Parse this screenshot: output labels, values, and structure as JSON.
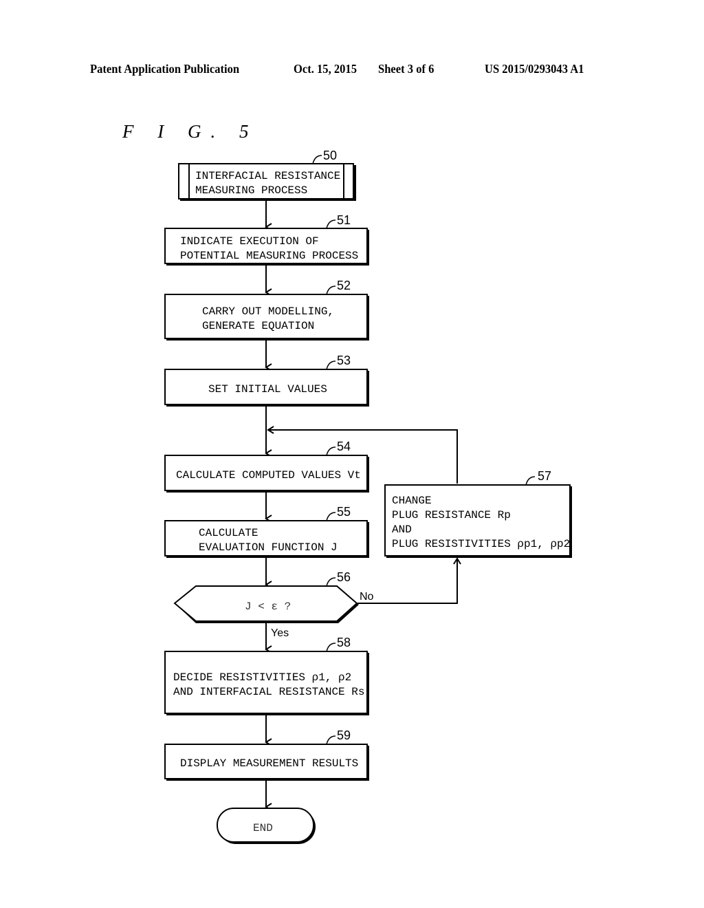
{
  "header": {
    "publication": "Patent Application Publication",
    "date": "Oct. 15, 2015",
    "sheet": "Sheet 3 of 6",
    "patent_number": "US 2015/0293043 A1"
  },
  "figure_label": "F I G. 5",
  "flowchart": {
    "steps": [
      {
        "ref": "50",
        "type": "predefined-process",
        "lines": [
          "INTERFACIAL RESISTANCE",
          "MEASURING PROCESS"
        ]
      },
      {
        "ref": "51",
        "type": "process",
        "lines": [
          "INDICATE EXECUTION OF",
          "POTENTIAL MEASURING PROCESS"
        ]
      },
      {
        "ref": "52",
        "type": "process",
        "lines": [
          "CARRY OUT MODELLING,",
          "GENERATE EQUATION"
        ]
      },
      {
        "ref": "53",
        "type": "process",
        "lines": [
          "SET INITIAL VALUES"
        ]
      },
      {
        "ref": "54",
        "type": "process",
        "lines": [
          "CALCULATE COMPUTED VALUES Vt"
        ]
      },
      {
        "ref": "55",
        "type": "process",
        "lines": [
          "CALCULATE",
          "EVALUATION FUNCTION J"
        ]
      },
      {
        "ref": "56",
        "type": "decision",
        "lines": [
          "J < ε ?"
        ]
      },
      {
        "ref": "57",
        "type": "process",
        "lines": [
          "CHANGE",
          "PLUG RESISTANCE Rp",
          "AND",
          "PLUG RESISTIVITIES ρp1, ρp2"
        ]
      },
      {
        "ref": "58",
        "type": "process",
        "lines": [
          "DECIDE RESISTIVITIES ρ1, ρ2",
          "AND INTERFACIAL RESISTANCE Rs"
        ]
      },
      {
        "ref": "59",
        "type": "process",
        "lines": [
          "DISPLAY MEASUREMENT RESULTS"
        ]
      },
      {
        "ref": "",
        "type": "terminator",
        "lines": [
          "END"
        ]
      }
    ],
    "branch_labels": {
      "no": "No",
      "yes": "Yes"
    }
  }
}
